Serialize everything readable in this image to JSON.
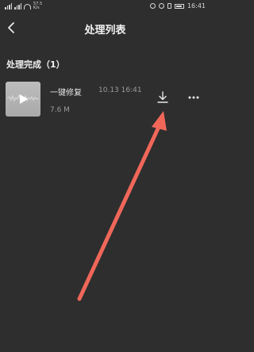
{
  "status_bar": {
    "speed_top": "57.5",
    "speed_bottom": "K/s",
    "time": "16:41"
  },
  "header": {
    "title": "处理列表",
    "back_icon": "chevron-left-icon"
  },
  "section": {
    "title": "处理完成（1）"
  },
  "items": [
    {
      "name": "一键修复",
      "time": "10.13 16:41",
      "size": "7.6 M",
      "thumbnail_icon": "play-icon",
      "action_icon": "download-icon",
      "menu_icon": "more-horizontal-icon"
    }
  ],
  "colors": {
    "background": "#2e2e2e",
    "annotation_arrow": "#f0675a"
  }
}
